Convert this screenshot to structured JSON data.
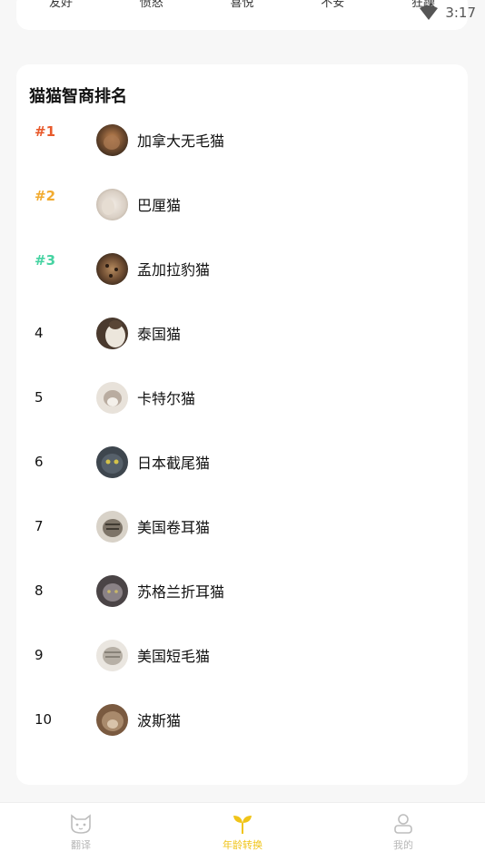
{
  "status_bar": {
    "time": "3:17"
  },
  "mood_bar": {
    "items": [
      "友好",
      "愤怒",
      "喜悦",
      "不安",
      "狂躁"
    ]
  },
  "ranking": {
    "title": "猫猫智商排名",
    "rows": [
      {
        "rank": "#1",
        "name": "加拿大无毛猫"
      },
      {
        "rank": "#2",
        "name": "巴厘猫"
      },
      {
        "rank": "#3",
        "name": "孟加拉豹猫"
      },
      {
        "rank": "4",
        "name": "泰国猫"
      },
      {
        "rank": "5",
        "name": "卡特尔猫"
      },
      {
        "rank": "6",
        "name": "日本截尾猫"
      },
      {
        "rank": "7",
        "name": "美国卷耳猫"
      },
      {
        "rank": "8",
        "name": "苏格兰折耳猫"
      },
      {
        "rank": "9",
        "name": "美国短毛猫"
      },
      {
        "rank": "10",
        "name": "波斯猫"
      }
    ]
  },
  "bottom_nav": {
    "items": [
      {
        "label": "翻译",
        "icon": "cat-face-icon",
        "active": false
      },
      {
        "label": "年龄转换",
        "icon": "sprout-icon",
        "active": true
      },
      {
        "label": "我的",
        "icon": "user-icon",
        "active": false
      }
    ]
  },
  "colors": {
    "rank_1": "#e85a2c",
    "rank_2": "#f2ab2f",
    "rank_3": "#46d3a2",
    "active_tab": "#f0c419"
  }
}
